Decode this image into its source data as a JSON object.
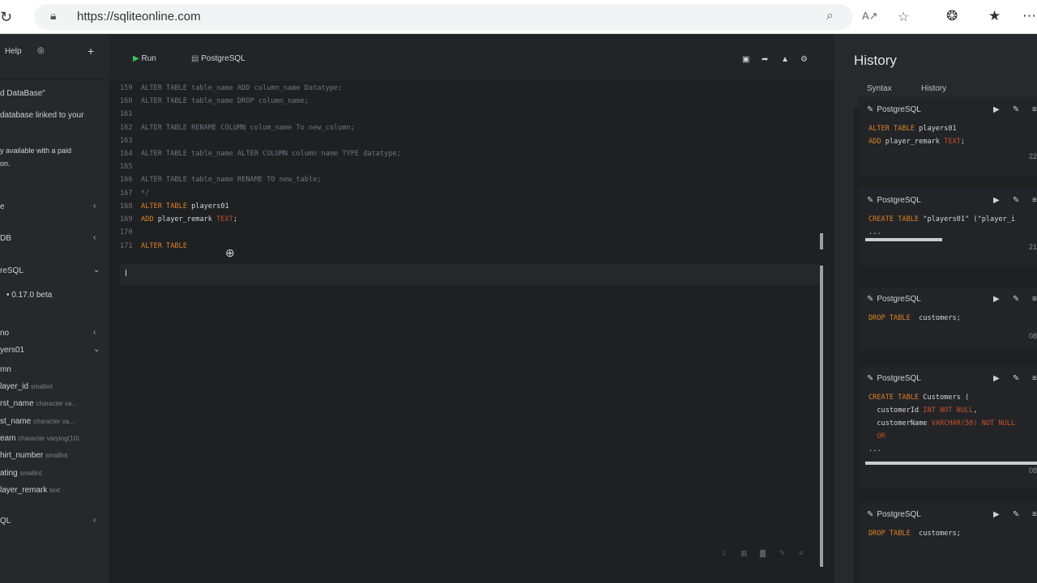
{
  "browser": {
    "url_host": "https://sqliteonline.com",
    "icons": [
      "reload-icon",
      "lock-icon",
      "zoom-icon",
      "read-aloud-icon",
      "favorite-icon",
      "extensions-icon",
      "favorites-bar-icon",
      "more-icon"
    ]
  },
  "sidebar": {
    "help": "Help",
    "items": [
      {
        "text": "d DataBase\""
      },
      {
        "text": "database linked to your"
      },
      {
        "text": "y available with a paid"
      },
      {
        "text": "on."
      },
      {
        "text": "e"
      },
      {
        "text": "DB"
      },
      {
        "text": "reSQL"
      },
      {
        "text": "0.17.0 beta"
      },
      {
        "text": "no"
      },
      {
        "text": "yers01"
      },
      {
        "text": "mn"
      }
    ],
    "columns": [
      {
        "name": "layer_id",
        "type": "smallint"
      },
      {
        "name": "rst_name",
        "type": "character va..."
      },
      {
        "name": "st_name",
        "type": "character va..."
      },
      {
        "name": "eam",
        "type": "character varying(10)"
      },
      {
        "name": "hirt_number",
        "type": "smallint"
      },
      {
        "name": "ating",
        "type": "smallint"
      },
      {
        "name": "layer_remark",
        "type": "text"
      }
    ],
    "bottom": "QL"
  },
  "toolbar": {
    "run_label": "Run",
    "db_label": "PostgreSQL"
  },
  "editor": {
    "lines": [
      {
        "n": "159",
        "text": "ALTER TABLE table_name ADD column_name Datatype;"
      },
      {
        "n": "160",
        "text": "ALTER TABLE table_name DROP column_name;"
      },
      {
        "n": "161",
        "text": ""
      },
      {
        "n": "162",
        "text": "ALTER TABLE RENAME COLUMN colum_name To new_column;"
      },
      {
        "n": "163",
        "text": ""
      },
      {
        "n": "164",
        "text": "ALTER TABLE table_name ALTER COLUMN column name TYPE datatype;"
      },
      {
        "n": "165",
        "text": ""
      },
      {
        "n": "166",
        "text": "ALTER TABLE table_name RENAME TO new_table;"
      },
      {
        "n": "167",
        "text": "*/"
      }
    ],
    "line168_kw": "ALTER TABLE",
    "line168_id": " players01",
    "line169_kw": "ADD",
    "line169_id": " player_remark",
    "line169_ty": " TEXT",
    "line169_end": ";",
    "line170": "",
    "line171_kw": "ALTER TABLE",
    "n168": "168",
    "n169": "169",
    "n170": "170",
    "n171": "171"
  },
  "history": {
    "title": "History",
    "tabs": [
      "Syntax",
      "History"
    ],
    "cards": [
      {
        "db": "PostgreSQL",
        "lines": [
          [
            "ALTER TABLE",
            " players01",
            "",
            ""
          ],
          [
            "ADD",
            " player_remark",
            " TEXT",
            ";"
          ]
        ],
        "num": "22"
      },
      {
        "db": "PostgreSQL",
        "lines": [
          [
            "CREATE TABLE",
            " \"players01\" (\"player_i",
            "",
            ""
          ],
          [
            "",
            "...",
            "",
            ""
          ]
        ],
        "num": "21"
      },
      {
        "db": "PostgreSQL",
        "lines": [
          [
            "DROP TABLE",
            "  customers;",
            "",
            ""
          ]
        ],
        "num": "08"
      },
      {
        "db": "PostgreSQL",
        "lines": [
          [
            "CREATE TABLE",
            " Customers (",
            "",
            ""
          ],
          [
            "",
            "  customerId",
            " INT NOT NULL",
            ","
          ],
          [
            "",
            "  customerName",
            " VARCHAR(50) NOT NULL",
            ""
          ],
          [
            "",
            "  ",
            "OR",
            ""
          ],
          [
            "",
            "...",
            "",
            ""
          ]
        ],
        "num": "08"
      },
      {
        "db": "PostgreSQL",
        "lines": [
          [
            "DROP TABLE",
            "  customers;",
            "",
            ""
          ]
        ],
        "num": ""
      }
    ]
  }
}
